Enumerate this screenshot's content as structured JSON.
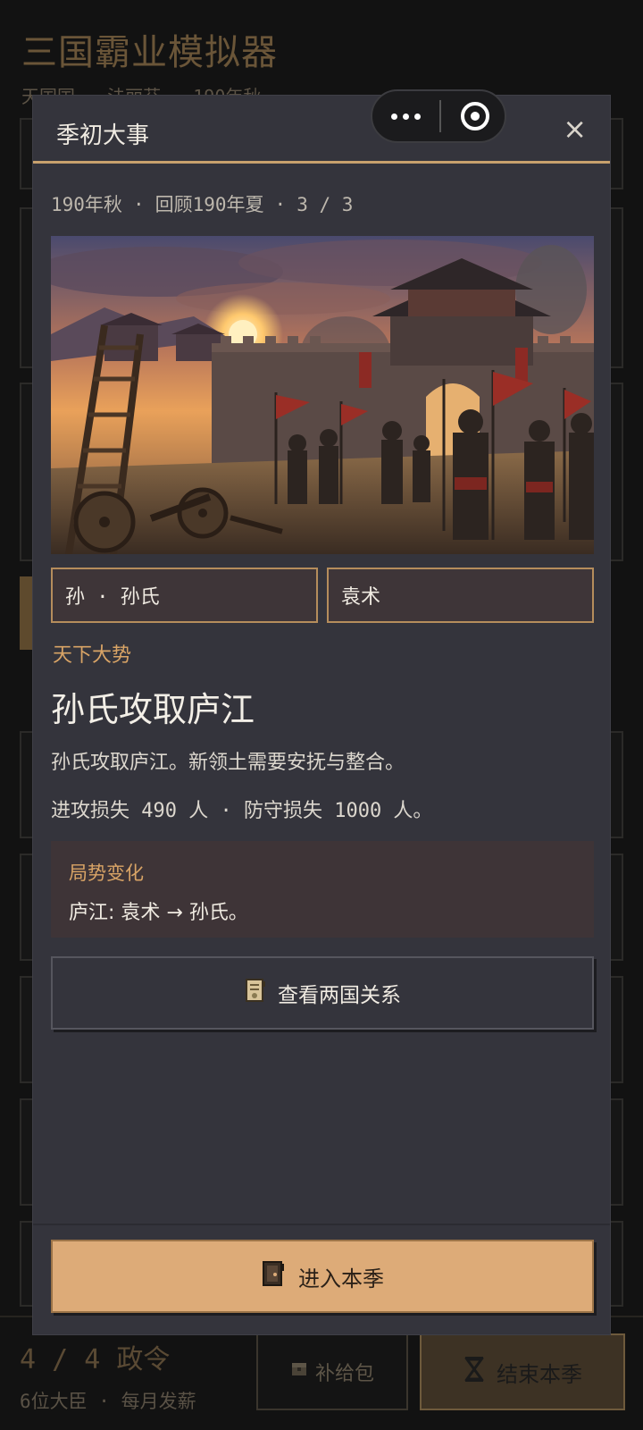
{
  "background": {
    "app_title": "三国霸业模拟器",
    "subtitle": "天国国 · 法丽芬 · 190年秋",
    "orders": "4 / 4 政令",
    "ministers": "6位大臣 · 每月发薪",
    "supply_button": "补给包",
    "end_season_button": "结束本季"
  },
  "modal": {
    "title": "季初大事",
    "close_glyph": "×",
    "meta": {
      "season": "190年秋",
      "review": "回顾190年夏",
      "page": "3 / 3"
    },
    "factions": [
      "孙 · 孙氏",
      "袁术"
    ],
    "category": "天下大势",
    "event_title": "孙氏攻取庐江",
    "event_description": "孙氏攻取庐江。新领土需要安抚与整合。",
    "casualties": "进攻损失 490 人 · 防守损失 1000 人。",
    "change_label": "局势变化",
    "change_text": "庐江: 袁术 → 孙氏。",
    "relation_button": "查看两国关系",
    "enter_button": "进入本季"
  },
  "colors": {
    "accent_gold": "#c8a16d",
    "category_orange": "#d9a466",
    "primary_button": "#ddab78",
    "modal_bg": "#34343c"
  }
}
